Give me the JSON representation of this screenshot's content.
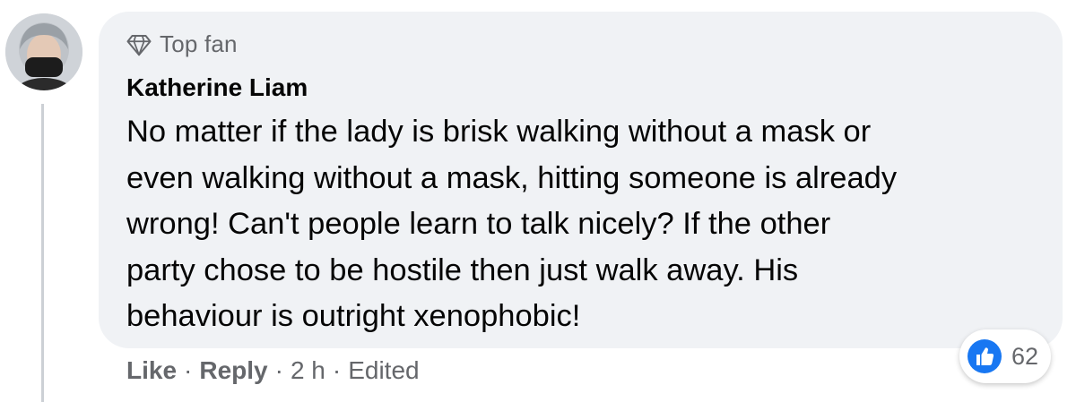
{
  "comment": {
    "badge": {
      "label": "Top fan",
      "icon": "diamond-icon"
    },
    "author": "Katherine Liam",
    "text": "No matter if the lady is brisk walking without a mask or\neven walking without a mask, hitting someone is already\nwrong! Can't people learn to talk nicely? If the other\nparty chose to be hostile then just walk away. His\nbehaviour is outright xenophobic!",
    "reactions": {
      "icon": "like-icon",
      "count": "62"
    },
    "actions": {
      "like_label": "Like",
      "reply_label": "Reply",
      "separator": "·",
      "time": "2 h",
      "edited_label": "Edited"
    }
  },
  "colors": {
    "bubble_background": "#f0f2f5",
    "secondary_text": "#65676b",
    "primary_text": "#050505",
    "like_blue": "#1877f2",
    "thread_line": "#ccd0d5"
  }
}
